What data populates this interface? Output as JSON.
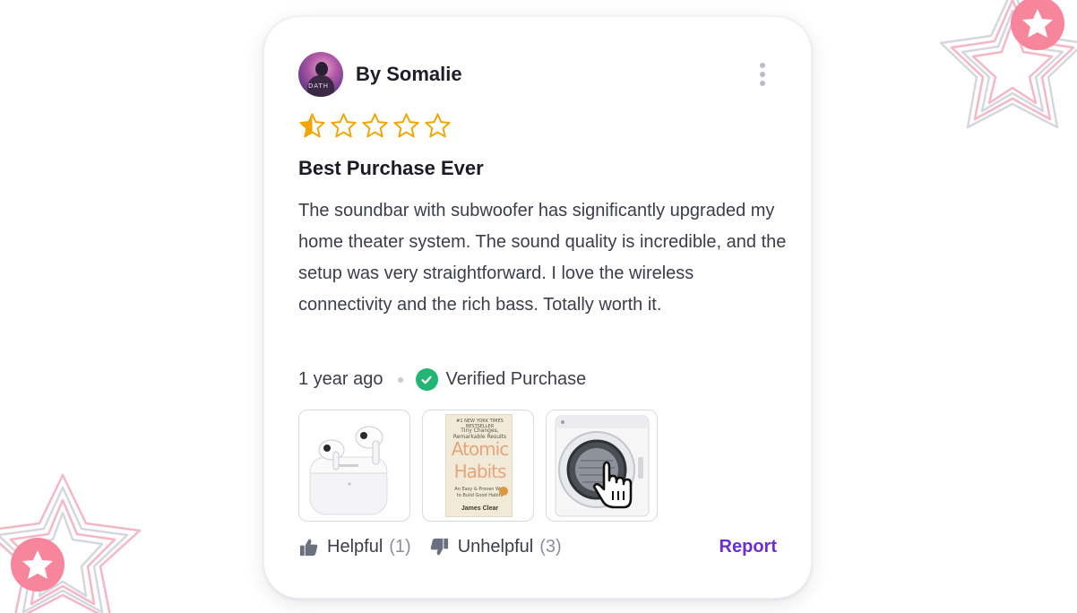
{
  "review": {
    "author": "By Somalie",
    "avatar_text": "DATH",
    "rating": 0.5,
    "max_rating": 5,
    "title": "Best Purchase Ever",
    "body": "The soundbar with subwoofer has significantly upgraded my home theater system. The sound quality is incredible, and the setup was very straightforward. I love the wireless connectivity and the rich bass. Totally worth it.",
    "time_ago": "1 year ago",
    "verified_label": "Verified Purchase"
  },
  "images": [
    {
      "name": "earbuds-thumbnail"
    },
    {
      "name": "book-thumbnail",
      "book_tagline": "Tiny Changes, Remarkable Results",
      "book_title_1": "Atomic",
      "book_title_2": "Habits",
      "book_author": "James Clear"
    },
    {
      "name": "dryer-thumbnail"
    }
  ],
  "actions": {
    "helpful_label": "Helpful",
    "helpful_count": "(1)",
    "unhelpful_label": "Unhelpful",
    "unhelpful_count": "(3)",
    "report_label": "Report"
  },
  "colors": {
    "star": "#f0a500",
    "verified": "#22b573",
    "report": "#6b2fd1",
    "decoration_accent": "#f7869c"
  },
  "icons": [
    "more-vertical-icon",
    "star-icon",
    "star-half-icon",
    "check-circle-icon",
    "thumbs-up-icon",
    "thumbs-down-icon",
    "pointer-hand-icon"
  ]
}
